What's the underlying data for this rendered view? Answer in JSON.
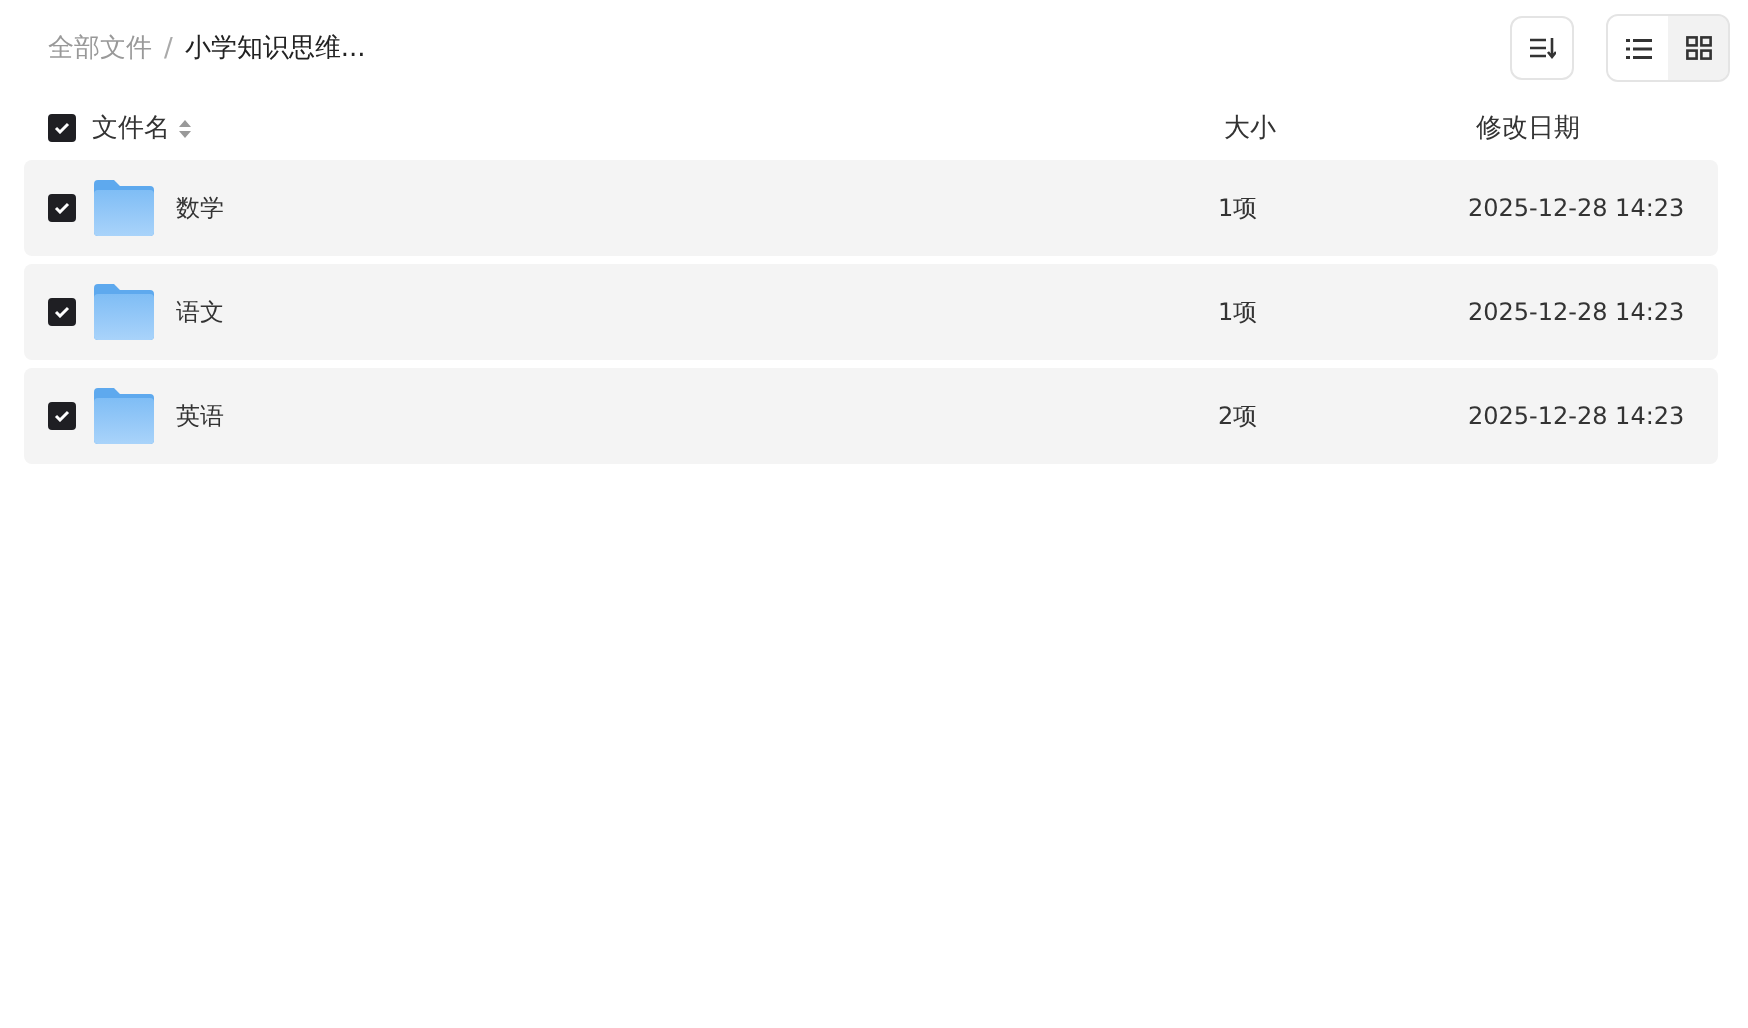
{
  "breadcrumb": [
    {
      "label": "全部文件",
      "current": false
    },
    {
      "label": "小学知识思维...",
      "current": true
    }
  ],
  "breadcrumb_separator": "/",
  "view_toggle": [
    {
      "kind": "list",
      "selected": true
    },
    {
      "kind": "grid",
      "selected": false
    }
  ],
  "table": {
    "select_all_checked": true,
    "columns": [
      "文件名",
      "大小",
      "修改日期"
    ],
    "rows": [
      {
        "name": "数学",
        "size": "1项",
        "modified": "2025-12-28 14:23",
        "checked": true
      },
      {
        "name": "语文",
        "size": "1项",
        "modified": "2025-12-28 14:23",
        "checked": true
      },
      {
        "name": "英语",
        "size": "2项",
        "modified": "2025-12-28 14:23",
        "checked": true
      }
    ]
  }
}
